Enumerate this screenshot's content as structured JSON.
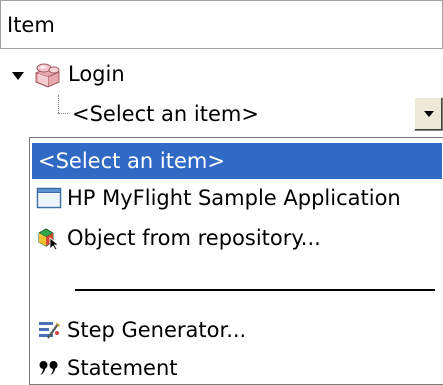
{
  "header": {
    "column_item": "Item"
  },
  "tree": {
    "login": {
      "label": "Login",
      "icon": "login-action-icon",
      "expanded": true
    },
    "combo": {
      "value": "<Select an item>",
      "button_icon": "dropdown-arrow-icon"
    }
  },
  "dropdown": {
    "items": [
      {
        "label": "<Select an item>",
        "selected": true
      },
      {
        "label": "HP MyFlight Sample Application",
        "icon": "window-icon"
      },
      {
        "label": "Object from repository...",
        "icon": "object-repository-icon"
      },
      {
        "label": "Step Generator...",
        "icon": "step-generator-icon"
      },
      {
        "label": "Statement",
        "icon": "statement-icon"
      }
    ]
  },
  "colors": {
    "selection": "#316ac5",
    "selection_text": "#ffffff"
  }
}
